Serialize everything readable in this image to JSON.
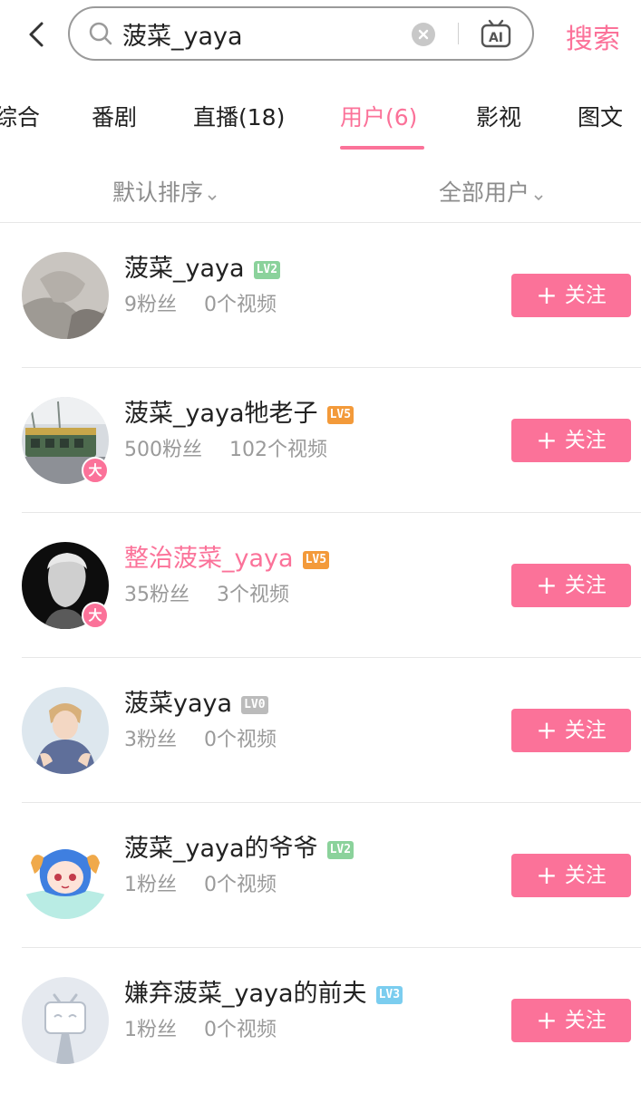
{
  "search": {
    "query": "菠菜_yaya",
    "button_label": "搜索",
    "ai_label": "AI"
  },
  "tabs": [
    {
      "label": "综合",
      "active": false
    },
    {
      "label": "番剧",
      "active": false
    },
    {
      "label": "直播(18)",
      "active": false
    },
    {
      "label": "用户(6)",
      "active": true
    },
    {
      "label": "影视",
      "active": false
    },
    {
      "label": "图文",
      "active": false
    }
  ],
  "filters": {
    "sort": "默认排序",
    "user_type": "全部用户"
  },
  "colors": {
    "accent": "#fb7299",
    "lv0": "#bbbbbb",
    "lv2": "#8bd29b",
    "lv3": "#7bcdef",
    "lv5": "#f39a3a"
  },
  "follow_label": "关注",
  "users": [
    {
      "name": "菠菜_yaya",
      "level": "LV2",
      "fans": "9粉丝",
      "videos": "0个视频",
      "verified_badge": "",
      "name_color": "default"
    },
    {
      "name": "菠菜_yaya牠老子",
      "level": "LV5",
      "fans": "500粉丝",
      "videos": "102个视频",
      "verified_badge": "大",
      "name_color": "default"
    },
    {
      "name": "整治菠菜_yaya",
      "level": "LV5",
      "fans": "35粉丝",
      "videos": "3个视频",
      "verified_badge": "大",
      "name_color": "pink"
    },
    {
      "name": "菠菜yaya",
      "level": "LV0",
      "fans": "3粉丝",
      "videos": "0个视频",
      "verified_badge": "",
      "name_color": "default"
    },
    {
      "name": "菠菜_yaya的爷爷",
      "level": "LV2",
      "fans": "1粉丝",
      "videos": "0个视频",
      "verified_badge": "",
      "name_color": "default"
    },
    {
      "name": "嫌弃菠菜_yaya的前夫",
      "level": "LV3",
      "fans": "1粉丝",
      "videos": "0个视频",
      "verified_badge": "",
      "name_color": "default"
    }
  ]
}
